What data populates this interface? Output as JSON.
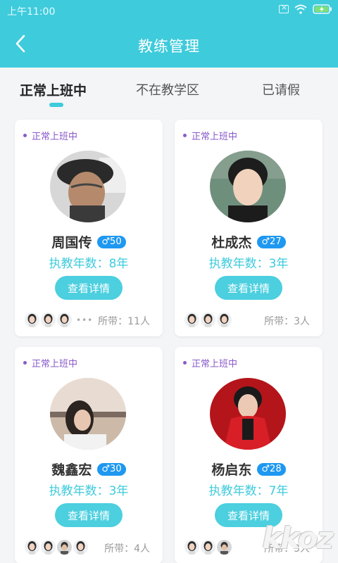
{
  "status_bar": {
    "time": "上午11:00"
  },
  "header": {
    "title": "教练管理"
  },
  "tabs": [
    {
      "label": "正常上班中",
      "active": true
    },
    {
      "label": "不在教学区",
      "active": false
    },
    {
      "label": "已请假",
      "active": false
    }
  ],
  "colors": {
    "primary": "#3ecbdc",
    "status_purple": "#8a5acb",
    "badge_blue": "#1e98f0"
  },
  "coaches": [
    {
      "status": "正常上班中",
      "name": "周国传",
      "age": "♂50",
      "years": "执教年数：8年",
      "button": "查看详情",
      "students_label": "所带：11人",
      "has_more": true
    },
    {
      "status": "正常上班中",
      "name": "杜成杰",
      "age": "♂27",
      "years": "执教年数：3年",
      "button": "查看详情",
      "students_label": "所带：3人",
      "has_more": false
    },
    {
      "status": "正常上班中",
      "name": "魏鑫宏",
      "age": "♂30",
      "years": "执教年数：3年",
      "button": "查看详情",
      "students_label": "所带：4人",
      "has_more": false
    },
    {
      "status": "正常上班中",
      "name": "杨启东",
      "age": "♂28",
      "years": "执教年数：7年",
      "button": "查看详情",
      "students_label": "所带：3人",
      "has_more": false
    }
  ],
  "more_indicator": "•••",
  "watermark": "kkoz"
}
